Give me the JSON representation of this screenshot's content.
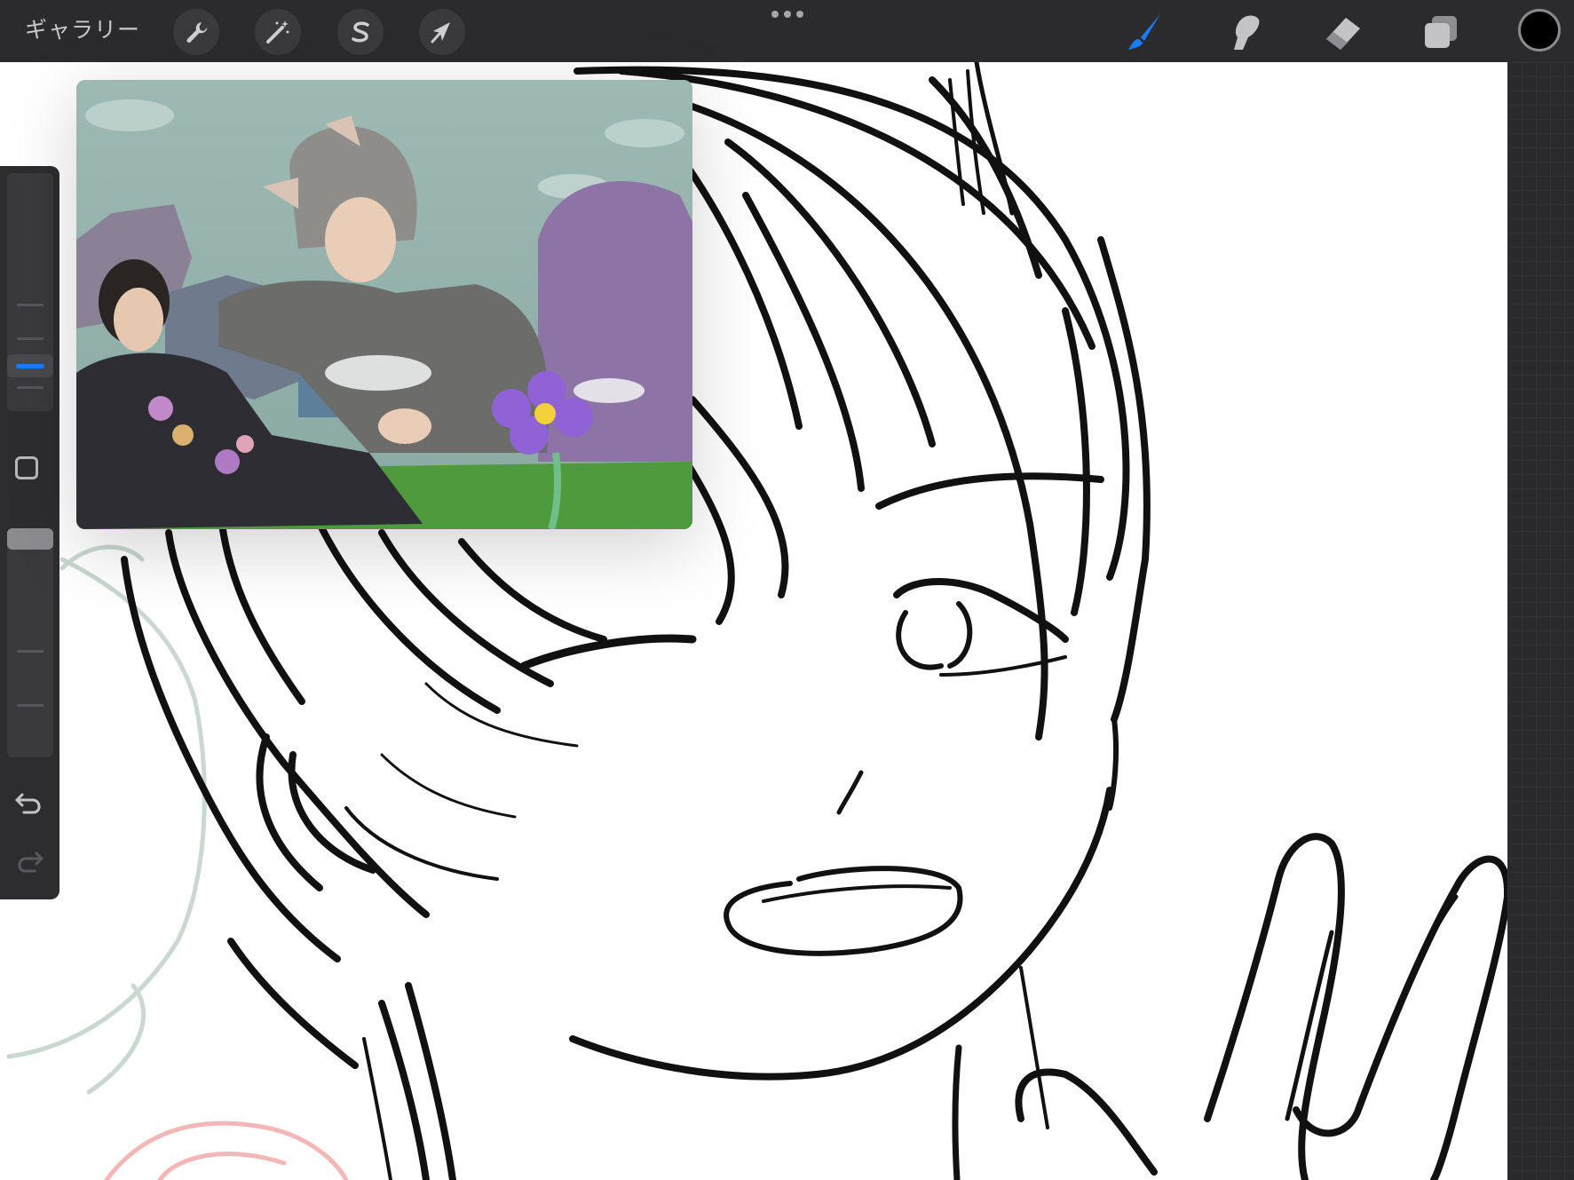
{
  "toolbar": {
    "gallery_label": "ギャラリー",
    "left_tools": [
      {
        "name": "actions-wrench",
        "icon": "wrench-icon"
      },
      {
        "name": "adjustments",
        "icon": "magic-wand-icon"
      },
      {
        "name": "selection",
        "icon": "selection-s-icon"
      },
      {
        "name": "transform",
        "icon": "arrow-cursor-icon"
      }
    ],
    "right_tools": [
      {
        "name": "brush",
        "icon": "brush-icon",
        "active": true
      },
      {
        "name": "smudge",
        "icon": "smudge-finger-icon"
      },
      {
        "name": "eraser",
        "icon": "eraser-icon"
      },
      {
        "name": "layers",
        "icon": "layers-icon"
      }
    ],
    "current_color": "#000000",
    "accent_color": "#1a7cff"
  },
  "sidebar": {
    "brush_size_slider": {
      "icon": "size-slider"
    },
    "modify_button": {
      "icon": "square-icon"
    },
    "opacity_slider": {
      "icon": "opacity-slider"
    },
    "undo": {
      "icon": "undo-icon"
    },
    "redo": {
      "icon": "redo-icon",
      "enabled": false
    }
  },
  "reference": {
    "description_icon": "reference-photo"
  },
  "canvas": {
    "background": "#ffffff",
    "grid_margin": "#2a2a2c"
  }
}
